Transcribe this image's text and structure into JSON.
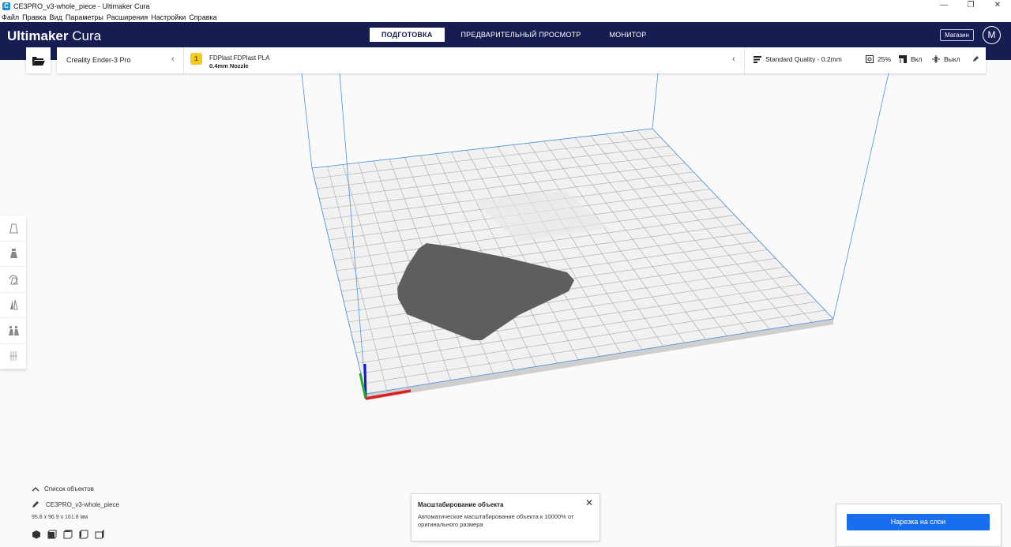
{
  "window": {
    "title": "CE3PRO_v3-whole_piece - Ultimaker Cura",
    "app_icon": "C",
    "minimize": "—",
    "maximize": "❐",
    "close": "✕"
  },
  "menu": [
    "Файл",
    "Правка",
    "Вид",
    "Параметры",
    "Расширения",
    "Настройки",
    "Справка"
  ],
  "header": {
    "logo_bold": "Ultimaker",
    "logo_light": " Cura",
    "tabs": [
      {
        "label": "ПОДГОТОВКА",
        "active": true
      },
      {
        "label": "ПРЕДВАРИТЕЛЬНЫЙ ПРОСМОТР",
        "active": false
      },
      {
        "label": "МОНИТОР",
        "active": false
      }
    ],
    "shop": "Магазин",
    "avatar": "M"
  },
  "toolbar": {
    "printer": "Creality Ender-3 Pro",
    "chevron": "‹",
    "material_badge": "1",
    "material_name": "FDPlast FDPlast PLA",
    "nozzle": "0.4mm Nozzle",
    "quality": "Standard Quality - 0.2mm",
    "infill": "25%",
    "support": "Вкл",
    "adhesion": "Выкл"
  },
  "object_list": {
    "toggle_label": "Список объектов",
    "file_name": "CE3PRO_v3-whole_piece",
    "dimensions": "95.8 x 96.9 x 161.8 мм"
  },
  "message": {
    "title": "Масштабирование объекта",
    "close": "✕",
    "body": "Автоматическое масштабирование объекта к 10000% от оригинального размера"
  },
  "slice": {
    "button": "Нарезка на слои"
  },
  "colors": {
    "header_bg": "#171d52",
    "accent_blue": "#196ef0",
    "material_yellow": "#f4c81c",
    "build_volume_line": "#4a90e2",
    "model_gray": "#5e5e5e"
  }
}
